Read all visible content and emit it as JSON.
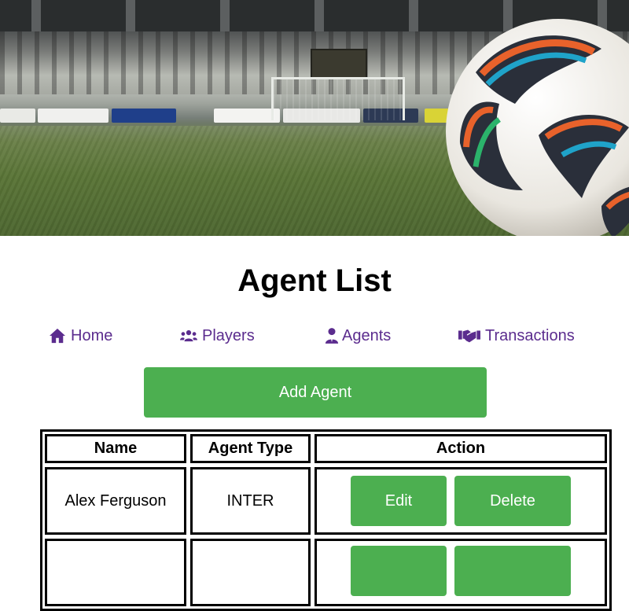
{
  "page": {
    "title": "Agent List"
  },
  "nav": {
    "items": [
      {
        "label": "Home",
        "icon": "home-icon"
      },
      {
        "label": "Players",
        "icon": "users-icon"
      },
      {
        "label": "Agents",
        "icon": "user-tie-icon"
      },
      {
        "label": "Transactions",
        "icon": "handshake-icon"
      }
    ]
  },
  "actions": {
    "add_label": "Add Agent"
  },
  "table": {
    "headers": [
      "Name",
      "Agent Type",
      "Action"
    ],
    "rows": [
      {
        "name": "Alex Ferguson",
        "type": "INTER",
        "edit_label": "Edit",
        "delete_label": "Delete"
      },
      {
        "name": "",
        "type": "",
        "edit_label": "",
        "delete_label": ""
      }
    ]
  },
  "colors": {
    "accent": "#4caf50",
    "nav_link": "#5b2c8e",
    "text": "#000000"
  }
}
